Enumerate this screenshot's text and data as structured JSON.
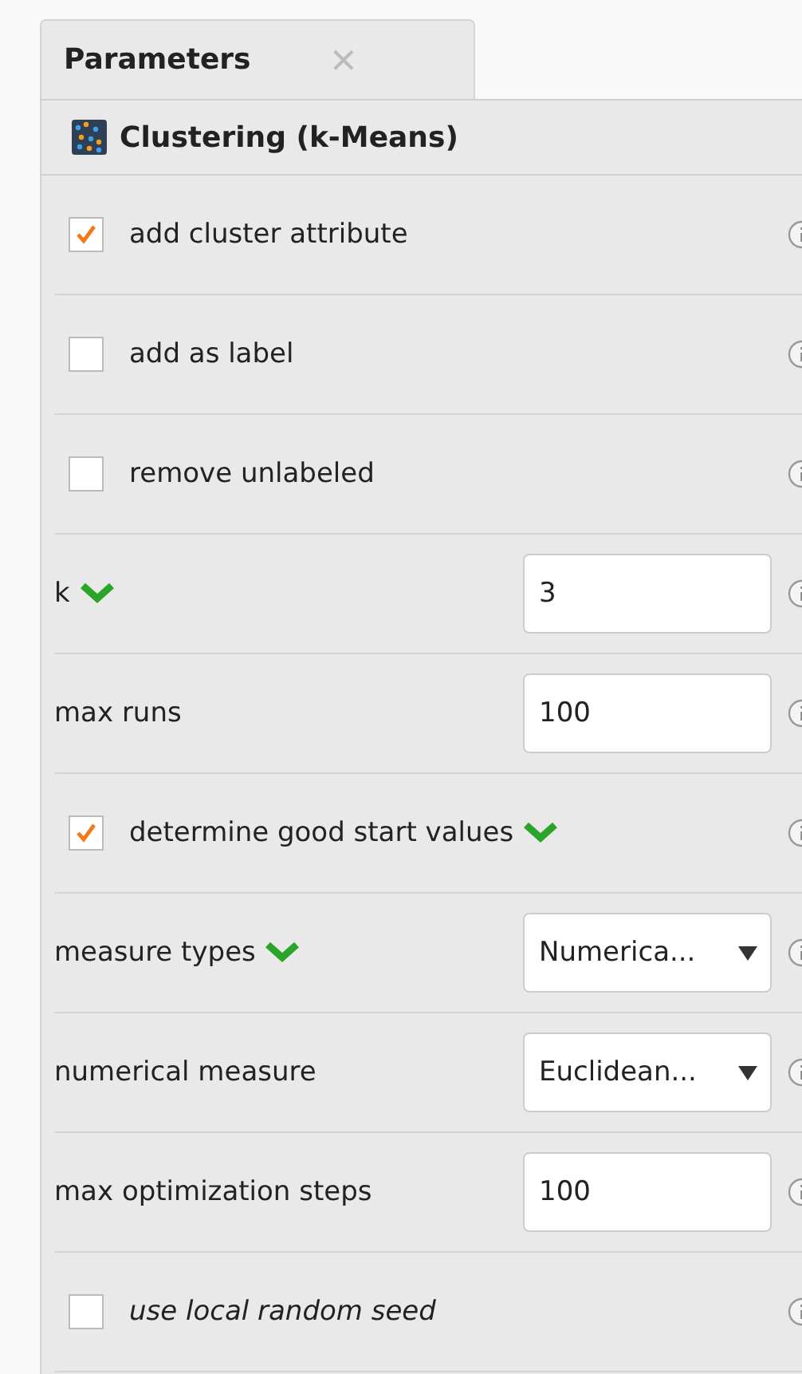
{
  "tab": {
    "label": "Parameters",
    "close": "×",
    "selected": true
  },
  "operator": {
    "title": "Clustering (k-Means)"
  },
  "parameters": [
    {
      "kind": "checkbox",
      "label": "add cluster attribute",
      "checked": true,
      "chevron": false,
      "italic": false
    },
    {
      "kind": "checkbox",
      "label": "add as label",
      "checked": false,
      "chevron": false,
      "italic": false
    },
    {
      "kind": "checkbox",
      "label": "remove unlabeled",
      "checked": false,
      "chevron": false,
      "italic": false
    },
    {
      "kind": "number",
      "label": "k",
      "value": "3",
      "chevron": true,
      "italic": false
    },
    {
      "kind": "number",
      "label": "max runs",
      "value": "100",
      "chevron": false,
      "italic": false
    },
    {
      "kind": "checkbox",
      "label": "determine good start values",
      "checked": true,
      "chevron": true,
      "italic": false
    },
    {
      "kind": "select",
      "label": "measure types",
      "value": "Numerica...",
      "chevron": true,
      "italic": false
    },
    {
      "kind": "select",
      "label": "numerical measure",
      "value": "Euclidean...",
      "chevron": false,
      "italic": false
    },
    {
      "kind": "number",
      "label": "max optimization steps",
      "value": "100",
      "chevron": false,
      "italic": false
    },
    {
      "kind": "checkbox",
      "label": "use local random seed",
      "checked": false,
      "chevron": false,
      "italic": true
    }
  ]
}
